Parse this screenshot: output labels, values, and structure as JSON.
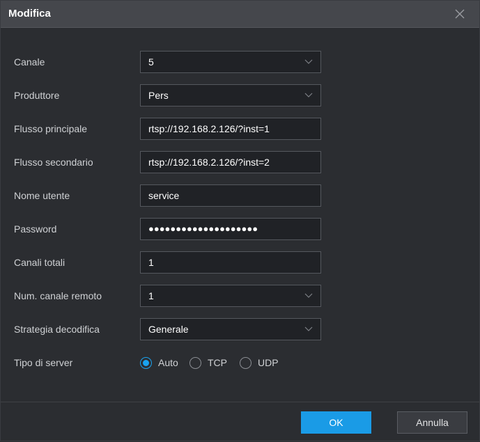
{
  "dialog": {
    "title": "Modifica"
  },
  "fields": {
    "canale": {
      "label": "Canale",
      "value": "5"
    },
    "produttore": {
      "label": "Produttore",
      "value": "Pers"
    },
    "flusso_principale": {
      "label": "Flusso principale",
      "value": "rtsp://192.168.2.126/?inst=1"
    },
    "flusso_secondario": {
      "label": "Flusso secondario",
      "value": "rtsp://192.168.2.126/?inst=2"
    },
    "nome_utente": {
      "label": "Nome utente",
      "value": "service"
    },
    "password": {
      "label": "Password",
      "value": "●●●●●●●●●●●●●●●●●●●●"
    },
    "canali_totali": {
      "label": "Canali totali",
      "value": "1"
    },
    "num_canale_remoto": {
      "label": "Num. canale remoto",
      "value": "1"
    },
    "strategia_decodifica": {
      "label": "Strategia decodifica",
      "value": "Generale"
    },
    "tipo_server": {
      "label": "Tipo di server",
      "options": [
        "Auto",
        "TCP",
        "UDP"
      ],
      "selected": "Auto"
    }
  },
  "footer": {
    "ok_label": "OK",
    "cancel_label": "Annulla"
  },
  "colors": {
    "accent": "#1a9be6",
    "background": "#2b2d31",
    "titlebar": "#45474c"
  },
  "icons": {
    "close": "close-icon",
    "dropdown": "chevron-down-icon"
  }
}
